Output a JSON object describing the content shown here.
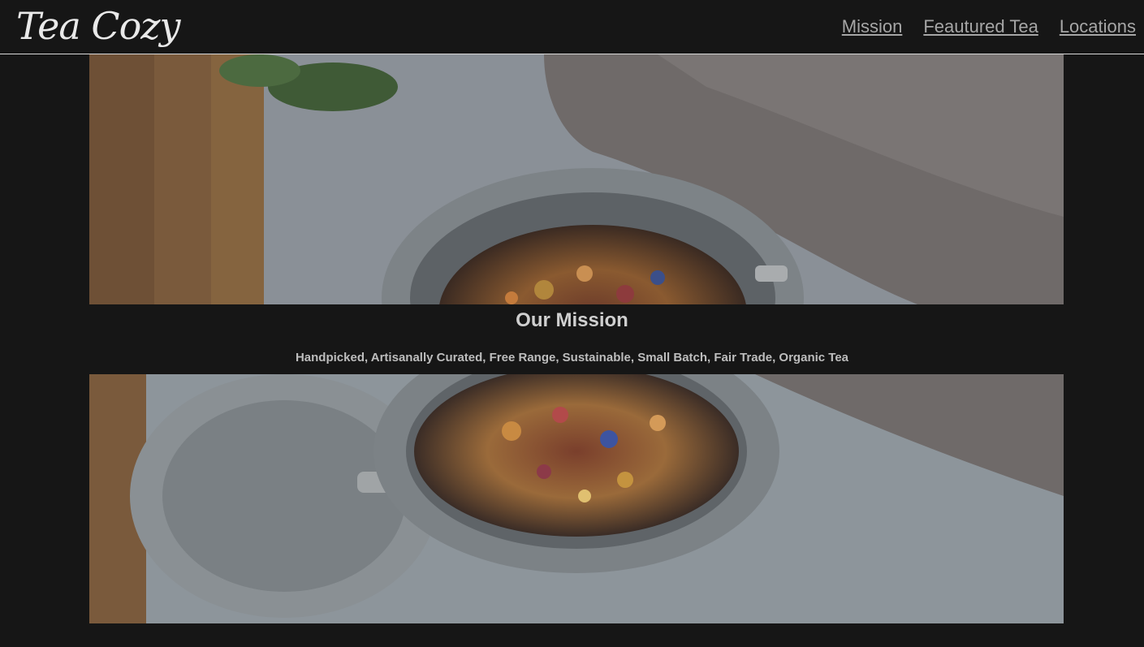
{
  "header": {
    "logo": "Tea Cozy",
    "nav": [
      "Mission",
      "Feautured Tea",
      "Locations"
    ]
  },
  "mission": {
    "title": "Our Mission",
    "subtitle": "Handpicked, Artisanally Curated, Free Range, Sustainable, Small Batch, Fair Trade, Organic Tea"
  },
  "colors": {
    "background": "#161616",
    "nav_link": "#a6a6a6",
    "logo": "#e9e9e9"
  }
}
